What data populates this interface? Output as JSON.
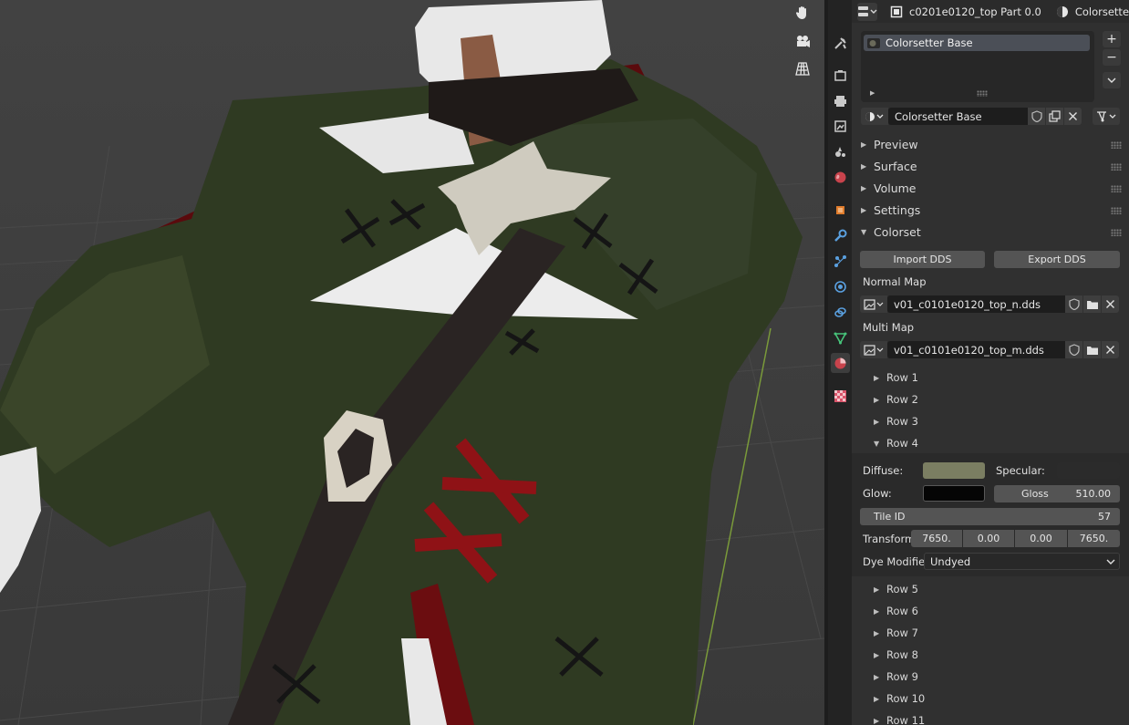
{
  "header": {
    "object_name": "c0201e0120_top Part 0.0",
    "material_name": "Colorsetter Ba"
  },
  "material_slots": {
    "items": [
      "Colorsetter Base"
    ],
    "add_symbol": "+",
    "remove_symbol": "−"
  },
  "material": {
    "name": "Colorsetter Base"
  },
  "sections": [
    {
      "label": "Preview",
      "expanded": false
    },
    {
      "label": "Surface",
      "expanded": false
    },
    {
      "label": "Volume",
      "expanded": false
    },
    {
      "label": "Settings",
      "expanded": false
    },
    {
      "label": "Colorset",
      "expanded": true
    }
  ],
  "colorset": {
    "import_label": "Import DDS",
    "export_label": "Export DDS",
    "normal_map_label": "Normal Map",
    "normal_map_file": "v01_c0101e0120_top_n.dds",
    "multi_map_label": "Multi Map",
    "multi_map_file": "v01_c0101e0120_top_m.dds",
    "rows_before": [
      "Row 1",
      "Row 2",
      "Row 3"
    ],
    "open_row": "Row 4",
    "rows_after": [
      "Row 5",
      "Row 6",
      "Row 7",
      "Row 8",
      "Row 9",
      "Row 10",
      "Row 11"
    ],
    "row4": {
      "diffuse_label": "Diffuse:",
      "diffuse_color": "#7b7e62",
      "specular_label": "Specular:",
      "specular_color": "#2b2b2b",
      "glow_label": "Glow:",
      "glow_color": "#050505",
      "gloss_label": "Gloss",
      "gloss_value": "510.00",
      "tile_id_label": "Tile ID",
      "tile_id_value": "57",
      "transform_label": "Transform:",
      "transform_values": [
        "7650.",
        "0.00",
        "0.00",
        "7650."
      ],
      "dye_modifier_label": "Dye Modifier:",
      "dye_modifier_value": "Undyed"
    }
  },
  "colors": {
    "cloth_green": "#2f3a22",
    "shirt_white": "#e8e8e8",
    "lining_red": "#6b0d10",
    "strap_dark": "#2a2423",
    "viewport_bg": "#3f3f3f"
  }
}
